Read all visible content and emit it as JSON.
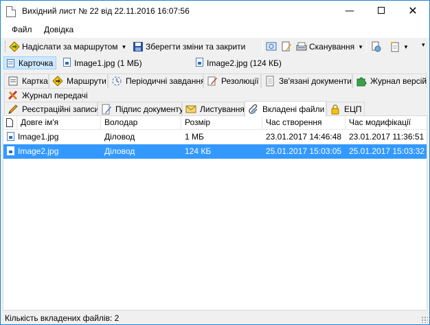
{
  "window": {
    "title": "Вихідний лист № 22 від 22.11.2016 16:07:56",
    "minimize": "—",
    "close": "✕"
  },
  "menu": [
    "Файл",
    "Довідка"
  ],
  "toolbar": {
    "send_route": "Надіслати за маршрутом",
    "save_close": "Зберегти зміни та закрити",
    "scanning": "Сканування",
    "dropdown_glyph": "▼"
  },
  "doc_tabs": [
    "Карточка",
    "Image1.jpg (1 МБ)",
    "Image2.jpg (124 КБ)"
  ],
  "tabs_row1": [
    "Картка",
    "Маршрути",
    "Періодичні завдання",
    "Резолюції",
    "Зв'язані документи",
    "Журнал версій"
  ],
  "tabs_row2": [
    "Журнал передачі"
  ],
  "tabs_row3": [
    "Реєстраційні записи",
    "Підпис документу",
    "Листування",
    "Вкладені файли",
    "ЕЦП"
  ],
  "active_tab": "Вкладені файли",
  "table": {
    "columns": [
      "Довге ім'я",
      "Володар",
      "Розмір",
      "Час створення",
      "Час модифікації"
    ],
    "rows": [
      {
        "name": "Image1.jpg",
        "owner": "Діловод",
        "size": "1 МБ",
        "created": "23.01.2017 14:46:48",
        "modified": "23.01.2017 11:36:51",
        "selected": false
      },
      {
        "name": "Image2.jpg",
        "owner": "Діловод",
        "size": "124 КБ",
        "created": "25.01.2017 15:03:05",
        "modified": "25.01.2017 15:03:32",
        "selected": true
      }
    ]
  },
  "status": "Кількість вкладених файлів: 2",
  "colors": {
    "selection": "#3399ff",
    "active_doc_tab": "#cde8ff",
    "window_border": "#1883d7"
  },
  "icons": {
    "send_route": "route-arrow-icon",
    "save": "floppy-disk-icon",
    "scan": "scanner-icon",
    "print": "printer-icon"
  }
}
